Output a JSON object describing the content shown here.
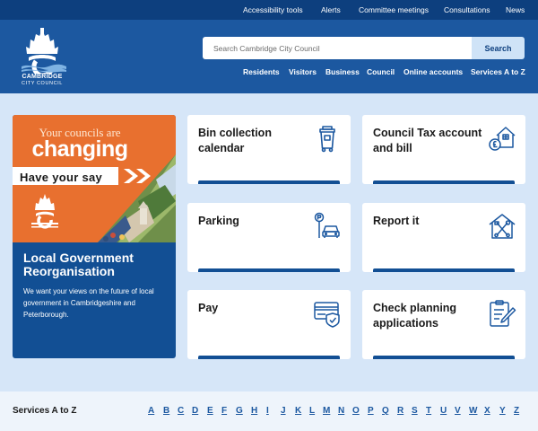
{
  "topbar": {
    "links": [
      "Accessibility tools",
      "Alerts",
      "Committee meetings",
      "Consultations",
      "News"
    ]
  },
  "logo": {
    "line1": "CAMBRIDGE",
    "line2": "CITY COUNCIL"
  },
  "search": {
    "placeholder": "Search Cambridge City Council",
    "button_label": "Search"
  },
  "mainnav": {
    "items": [
      "Residents",
      "Visitors",
      "Business",
      "Council",
      "Online accounts",
      "Services A to Z"
    ]
  },
  "promo": {
    "line1": "Your councils are",
    "line2": "changing",
    "line3": "Have your say",
    "title": "Local Government Reorganisation",
    "description": "We want your views on the future of local government in Cambridgeshire and Peterborough."
  },
  "cards": [
    {
      "title": "Bin collection calendar",
      "icon": "wheelie-bin-icon"
    },
    {
      "title": "Council Tax account and bill",
      "icon": "house-pound-icon"
    },
    {
      "title": "Parking",
      "icon": "parking-car-icon"
    },
    {
      "title": "Report it",
      "icon": "house-tools-icon"
    },
    {
      "title": "Pay",
      "icon": "card-shield-icon"
    },
    {
      "title": "Check planning applications",
      "icon": "clipboard-pen-icon"
    }
  ],
  "az": {
    "label": "Services A to Z",
    "letters": [
      "A",
      "B",
      "C",
      "D",
      "E",
      "F",
      "G",
      "H",
      "I",
      "J",
      "K",
      "L",
      "M",
      "N",
      "O",
      "P",
      "Q",
      "R",
      "S",
      "T",
      "U",
      "V",
      "W",
      "X",
      "Y",
      "Z"
    ]
  },
  "colors": {
    "topbar": "#0d3f7e",
    "header": "#1c58a0",
    "page_bg": "#d6e6f8",
    "promo_orange": "#e8702f",
    "accent_dark": "#124f94"
  }
}
